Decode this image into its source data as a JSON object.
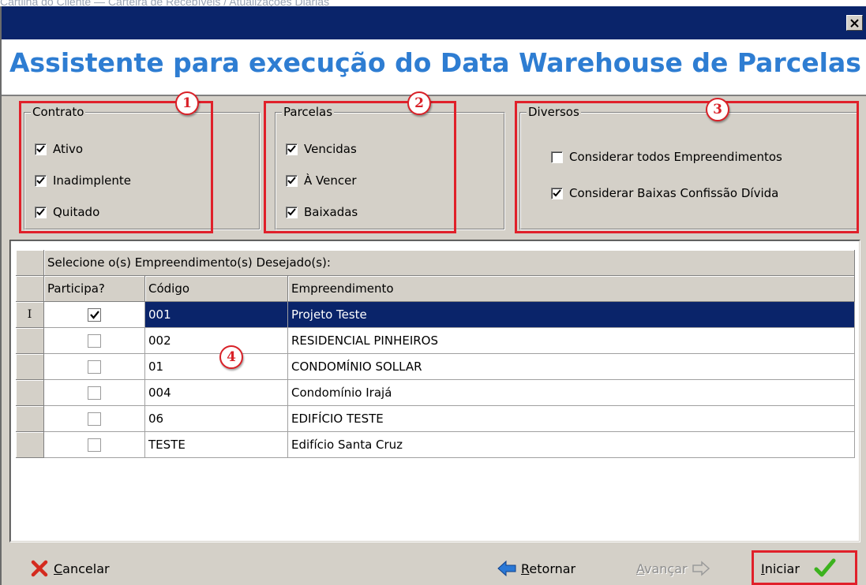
{
  "caption": "Cartilha do Cliente — Carteira de Recebíveis / Atualizações Diárias",
  "window": {
    "title_bar_color": "#0a246a",
    "close_icon": "close-icon"
  },
  "wizard": {
    "title": "Assistente para execução do Data Warehouse de Parcelas",
    "title_color": "#2e7dd2"
  },
  "groups": {
    "contrato": {
      "legend": "Contrato",
      "items": [
        {
          "label": "Ativo",
          "checked": true
        },
        {
          "label": "Inadimplente",
          "checked": true
        },
        {
          "label": "Quitado",
          "checked": true
        }
      ]
    },
    "parcelas": {
      "legend": "Parcelas",
      "items": [
        {
          "label": "Vencidas",
          "checked": true
        },
        {
          "label": "À Vencer",
          "checked": true
        },
        {
          "label": "Baixadas",
          "checked": true
        }
      ]
    },
    "diversos": {
      "legend": "Diversos",
      "items": [
        {
          "label": "Considerar todos Empreendimentos",
          "checked": false
        },
        {
          "label": "Considerar Baixas Confissão Dívida",
          "checked": true
        }
      ]
    }
  },
  "annotations": {
    "badge1": "1",
    "badge2": "2",
    "badge3": "3",
    "badge4": "4",
    "color": "#e0202a"
  },
  "grid": {
    "caption": "Selecione o(s) Empreendimento(s) Desejado(s):",
    "columns": {
      "participa": "Participa?",
      "codigo": "Código",
      "empreendimento": "Empreendimento"
    },
    "active_row_marker": "I",
    "selected_color": "#0a246a",
    "rows": [
      {
        "participa": true,
        "codigo": "001",
        "empreendimento": "Projeto Teste",
        "selected": true
      },
      {
        "participa": false,
        "codigo": "002",
        "empreendimento": "RESIDENCIAL PINHEIROS",
        "selected": false
      },
      {
        "participa": false,
        "codigo": "01",
        "empreendimento": "CONDOMÍNIO SOLLAR",
        "selected": false
      },
      {
        "participa": false,
        "codigo": "004",
        "empreendimento": "Condomínio Irajá",
        "selected": false
      },
      {
        "participa": false,
        "codigo": "06",
        "empreendimento": "EDIFÍCIO TESTE",
        "selected": false
      },
      {
        "participa": false,
        "codigo": "TESTE",
        "empreendimento": "Edifício Santa Cruz",
        "selected": false
      }
    ]
  },
  "footer": {
    "cancel_first": "C",
    "cancel_rest": "ancelar",
    "back_first": "R",
    "back_rest": "etornar",
    "next_first": "A",
    "next_rest": "vançar",
    "start_first": "I",
    "start_rest": "niciar",
    "icons": {
      "cancel": "red-x-icon",
      "back": "blue-left-arrow-icon",
      "next": "gray-right-arrow-icon",
      "start": "green-check-icon"
    }
  }
}
